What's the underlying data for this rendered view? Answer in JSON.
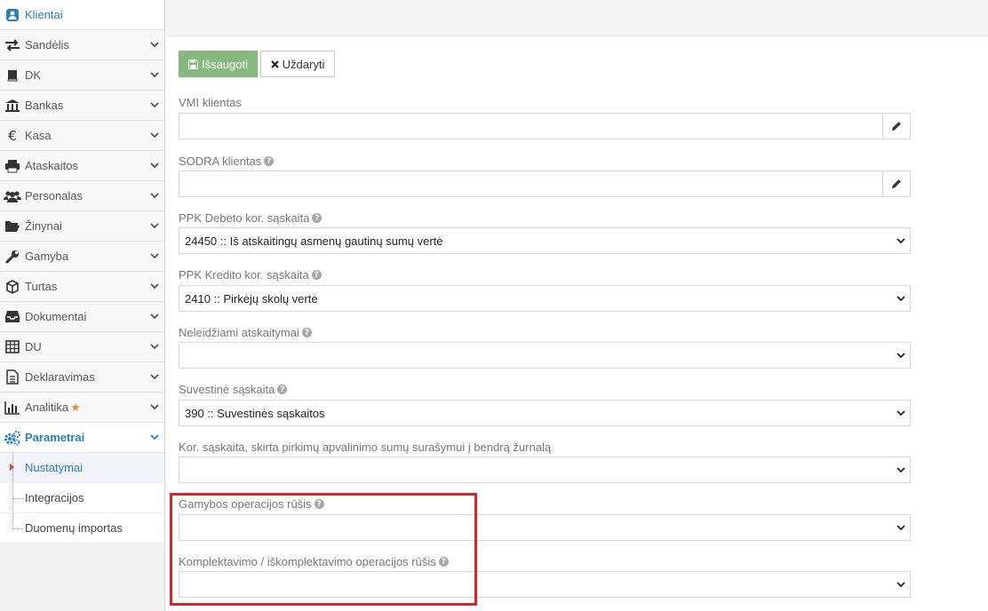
{
  "sidebar": {
    "items": [
      {
        "label": "Klientai",
        "icon": "user-icon"
      },
      {
        "label": "Sandėlis",
        "icon": "exchange-icon"
      },
      {
        "label": "DK",
        "icon": "book-icon"
      },
      {
        "label": "Bankas",
        "icon": "bank-icon"
      },
      {
        "label": "Kasa",
        "icon": "euro-icon"
      },
      {
        "label": "Ataskaitos",
        "icon": "print-icon"
      },
      {
        "label": "Personalas",
        "icon": "users-icon"
      },
      {
        "label": "Žinynai",
        "icon": "folder-icon"
      },
      {
        "label": "Gamyba",
        "icon": "wrench-icon"
      },
      {
        "label": "Turtas",
        "icon": "cube-icon"
      },
      {
        "label": "Dokumentai",
        "icon": "inbox-icon"
      },
      {
        "label": "DU",
        "icon": "table-icon"
      },
      {
        "label": "Deklaravimas",
        "icon": "file-icon"
      },
      {
        "label": "Analitika",
        "icon": "bar-chart-icon"
      },
      {
        "label": "Parametrai",
        "icon": "gears-icon"
      }
    ],
    "submenu": [
      {
        "label": "Nustatymai"
      },
      {
        "label": "Integracijos"
      },
      {
        "label": "Duomenų importas"
      }
    ]
  },
  "toolbar": {
    "save_label": "Išsaugoti",
    "close_label": "Uždaryti"
  },
  "form": {
    "vmi_label": "VMI klientas",
    "vmi_value": "",
    "sodra_label": "SODRA klientas",
    "sodra_value": "",
    "ppk_debit_label": "PPK Debeto kor. sąskaita",
    "ppk_debit_value": "24450 :: Iš atskaitingų asmenų gautinų sumų vertė",
    "ppk_credit_label": "PPK Kredito kor. sąskaita",
    "ppk_credit_value": "2410 :: Pirkėjų skolų vertė",
    "nondeductible_label": "Neleidžiami atskaitymai",
    "nondeductible_value": "",
    "summary_label": "Suvestinė sąskaita",
    "summary_value": "390 :: Suvestinės sąskaitos",
    "rounding_label": "Kor. sąskaita, skirta pirkimų apvalinimo sumų surašymui į bendrą žurnalą",
    "rounding_value": "",
    "production_label": "Gamybos operacijos rūšis",
    "production_value": "",
    "assembly_label": "Komplektavimo / iškomplektavimo operacijos rūšis",
    "assembly_value": ""
  },
  "colors": {
    "accent": "#2b7dbc",
    "save_button": "#87b87f",
    "highlight": "#d9232a",
    "star": "#f0883a"
  }
}
